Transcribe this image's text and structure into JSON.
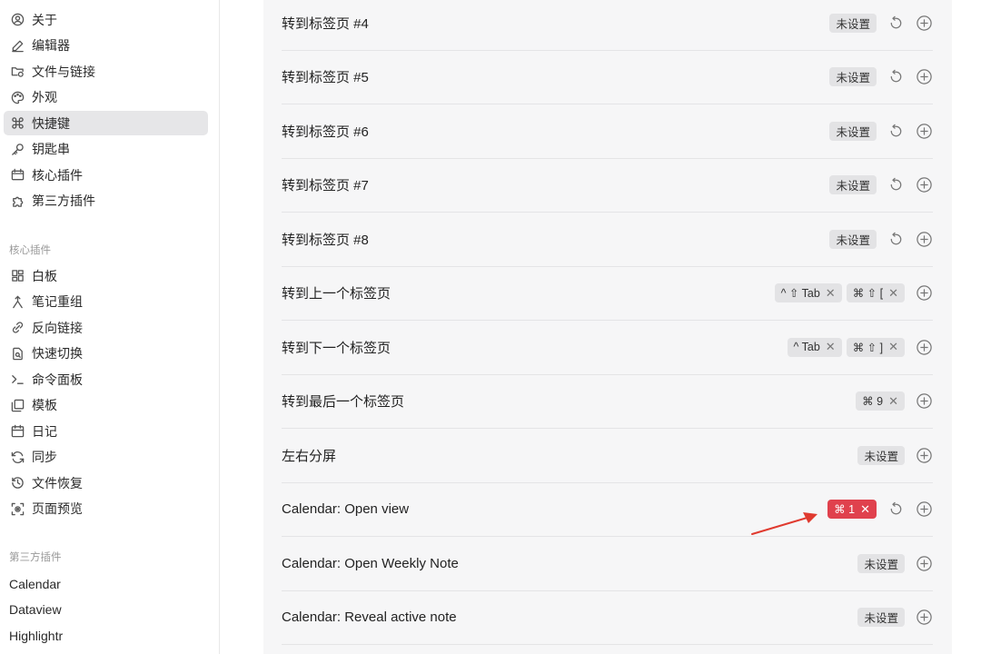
{
  "sidebar": {
    "general_items": [
      {
        "label": "关于",
        "icon": "user-circle-icon"
      },
      {
        "label": "编辑器",
        "icon": "pen-icon"
      },
      {
        "label": "文件与链接",
        "icon": "folder-link-icon"
      },
      {
        "label": "外观",
        "icon": "palette-icon"
      },
      {
        "label": "快捷键",
        "icon": "command-icon",
        "active": true
      },
      {
        "label": "钥匙串",
        "icon": "key-icon"
      },
      {
        "label": "核心插件",
        "icon": "plugin-box-icon"
      },
      {
        "label": "第三方插件",
        "icon": "puzzle-icon"
      }
    ],
    "core_plugins_label": "核心插件",
    "core_plugins": [
      {
        "label": "白板",
        "icon": "canvas-grid-icon"
      },
      {
        "label": "笔记重组",
        "icon": "merge-icon"
      },
      {
        "label": "反向链接",
        "icon": "backlink-icon"
      },
      {
        "label": "快速切换",
        "icon": "quick-switch-icon"
      },
      {
        "label": "命令面板",
        "icon": "terminal-icon"
      },
      {
        "label": "模板",
        "icon": "template-icon"
      },
      {
        "label": "日记",
        "icon": "calendar-icon"
      },
      {
        "label": "同步",
        "icon": "sync-icon"
      },
      {
        "label": "文件恢复",
        "icon": "history-icon"
      },
      {
        "label": "页面预览",
        "icon": "preview-icon"
      }
    ],
    "third_party_label": "第三方插件",
    "third_party_plugins": [
      "Calendar",
      "Dataview",
      "Highlightr"
    ]
  },
  "hotkeys": [
    {
      "label": "转到标签页 #4",
      "chips": [
        {
          "text": "未设置",
          "removable": false
        }
      ],
      "reset": true
    },
    {
      "label": "转到标签页 #5",
      "chips": [
        {
          "text": "未设置",
          "removable": false
        }
      ],
      "reset": true
    },
    {
      "label": "转到标签页 #6",
      "chips": [
        {
          "text": "未设置",
          "removable": false
        }
      ],
      "reset": true
    },
    {
      "label": "转到标签页 #7",
      "chips": [
        {
          "text": "未设置",
          "removable": false
        }
      ],
      "reset": true
    },
    {
      "label": "转到标签页 #8",
      "chips": [
        {
          "text": "未设置",
          "removable": false
        }
      ],
      "reset": true
    },
    {
      "label": "转到上一个标签页",
      "chips": [
        {
          "text": "^ ⇧ Tab",
          "removable": true
        },
        {
          "text": "⌘ ⇧ [",
          "removable": true
        }
      ],
      "reset": false
    },
    {
      "label": "转到下一个标签页",
      "chips": [
        {
          "text": "^ Tab",
          "removable": true
        },
        {
          "text": "⌘ ⇧ ]",
          "removable": true
        }
      ],
      "reset": false
    },
    {
      "label": "转到最后一个标签页",
      "chips": [
        {
          "text": "⌘ 9",
          "removable": true
        }
      ],
      "reset": false
    },
    {
      "label": "左右分屏",
      "chips": [
        {
          "text": "未设置",
          "removable": false
        }
      ],
      "reset": false
    },
    {
      "label": "Calendar: Open view",
      "chips": [
        {
          "text": "⌘ 1",
          "removable": true,
          "highlight": true
        }
      ],
      "reset": true
    },
    {
      "label": "Calendar: Open Weekly Note",
      "chips": [
        {
          "text": "未设置",
          "removable": false
        }
      ],
      "reset": false
    },
    {
      "label": "Calendar: Reveal active note",
      "chips": [
        {
          "text": "未设置",
          "removable": false
        }
      ],
      "reset": false
    }
  ],
  "remove_glyph": "✕",
  "colors": {
    "highlight_chip": "#e0414d",
    "arrow": "#e03a2f",
    "active_nav": "#e6e6e8"
  }
}
